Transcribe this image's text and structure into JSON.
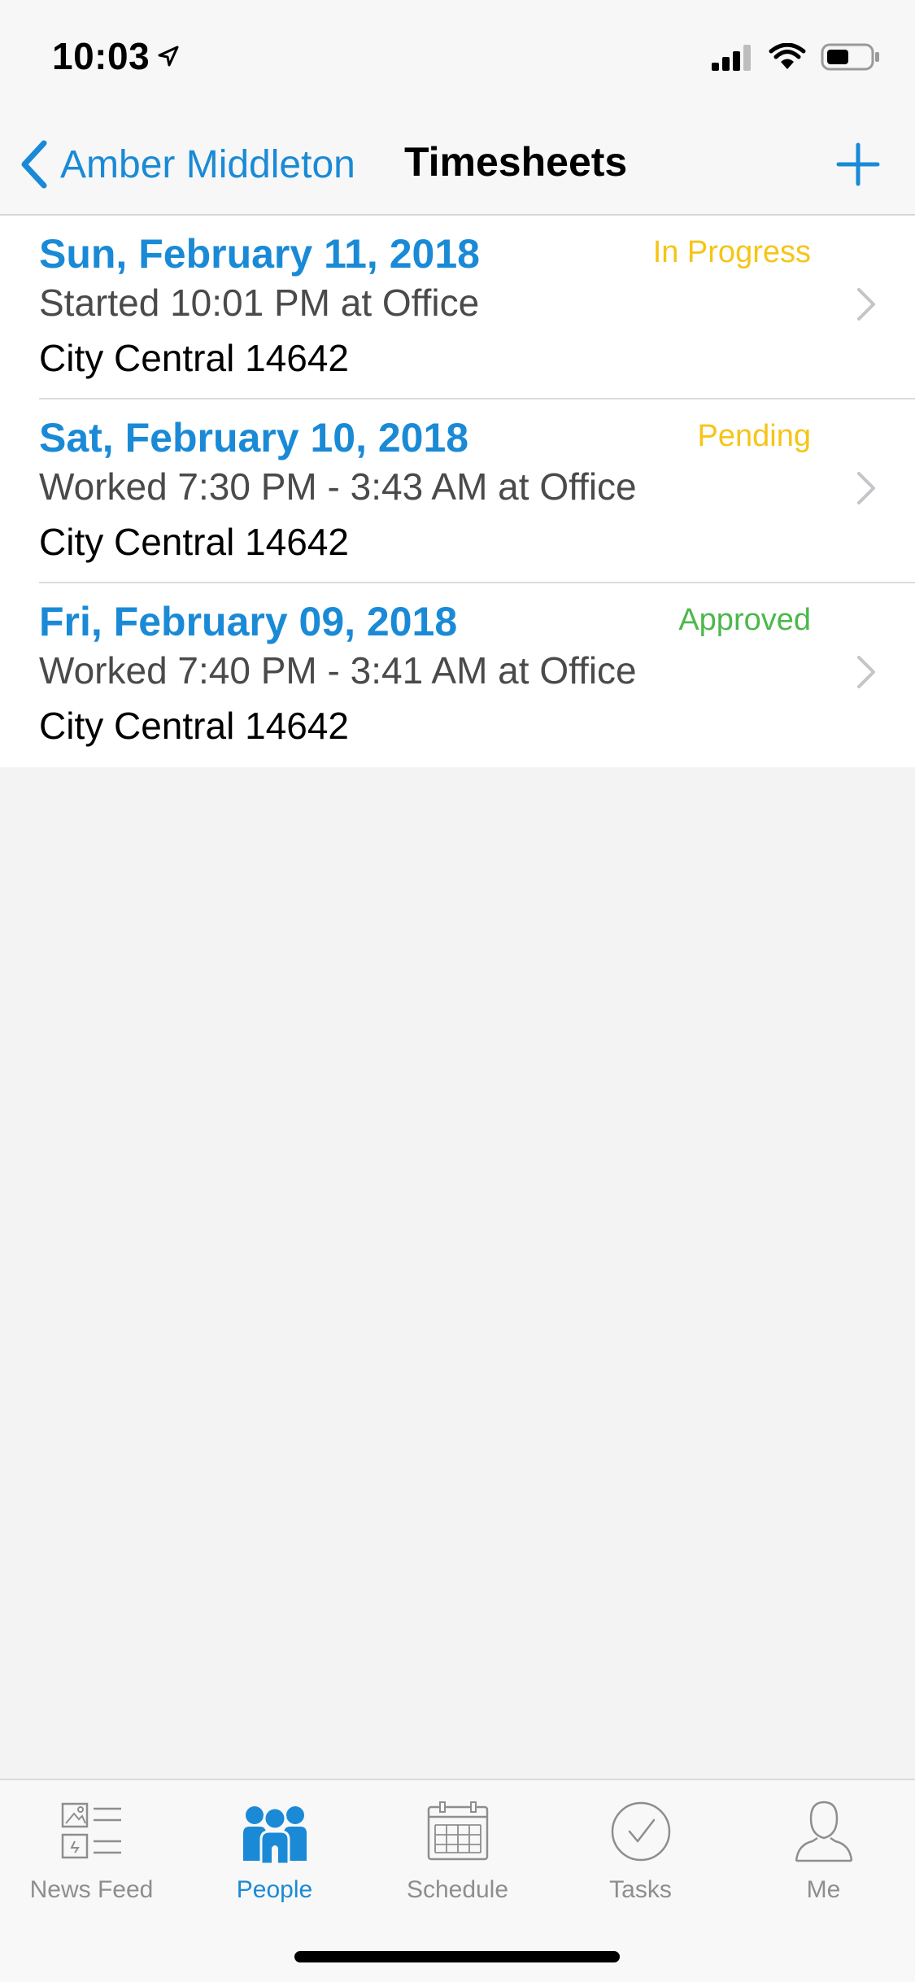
{
  "status_bar": {
    "time": "10:03",
    "icons": [
      "location-arrow-icon",
      "signal-icon",
      "wifi-icon",
      "battery-icon"
    ]
  },
  "nav": {
    "back_label": "Amber Middleton",
    "title": "Timesheets",
    "add_icon": "plus-icon"
  },
  "timesheets": [
    {
      "date": "Sun, February 11, 2018",
      "status": "In Progress",
      "status_color": "#f5c518",
      "detail": "Started 10:01 PM at Office",
      "location": "City Central 14642"
    },
    {
      "date": "Sat, February 10, 2018",
      "status": "Pending",
      "status_color": "#f5c518",
      "detail": "Worked 7:30 PM - 3:43 AM at Office",
      "location": "City Central 14642"
    },
    {
      "date": "Fri, February 09, 2018",
      "status": "Approved",
      "status_color": "#4cb84c",
      "detail": "Worked 7:40 PM - 3:41 AM at Office",
      "location": "City Central 14642"
    }
  ],
  "tab_bar": {
    "active": "People",
    "tabs": [
      {
        "label": "News Feed",
        "icon": "news-feed-icon"
      },
      {
        "label": "People",
        "icon": "people-icon"
      },
      {
        "label": "Schedule",
        "icon": "calendar-icon"
      },
      {
        "label": "Tasks",
        "icon": "checkmark-circle-icon"
      },
      {
        "label": "Me",
        "icon": "person-icon"
      }
    ]
  },
  "colors": {
    "accent": "#1a8ad6",
    "pending": "#f5c518",
    "approved": "#4cb84c",
    "tab_inactive": "#8e8e8e"
  }
}
